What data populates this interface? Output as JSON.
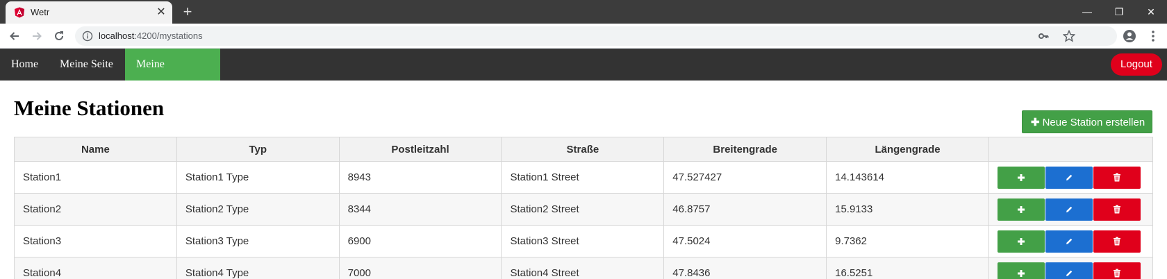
{
  "browser": {
    "tab_title": "Wetr",
    "url_host": "localhost",
    "url_path": ":4200/mystations"
  },
  "navbar": {
    "links": [
      {
        "label": "Home"
      },
      {
        "label": "Meine Seite"
      },
      {
        "label": "Meine Stationen",
        "active": true
      }
    ],
    "logout_label": "Logout"
  },
  "page": {
    "title": "Meine Stationen",
    "new_station_label": "Neue Station erstellen"
  },
  "table": {
    "columns": [
      "Name",
      "Typ",
      "Postleitzahl",
      "Straße",
      "Breitengrade",
      "Längengrade"
    ],
    "rows": [
      {
        "name": "Station1",
        "typ": "Station1 Type",
        "plz": "8943",
        "strasse": "Station1 Street",
        "breite": "47.527427",
        "laenge": "14.143614"
      },
      {
        "name": "Station2",
        "typ": "Station2 Type",
        "plz": "8344",
        "strasse": "Station2 Street",
        "breite": "46.8757",
        "laenge": "15.9133"
      },
      {
        "name": "Station3",
        "typ": "Station3 Type",
        "plz": "6900",
        "strasse": "Station3 Street",
        "breite": "47.5024",
        "laenge": "9.7362"
      },
      {
        "name": "Station4",
        "typ": "Station4 Type",
        "plz": "7000",
        "strasse": "Station4 Street",
        "breite": "47.8436",
        "laenge": "16.5251"
      }
    ]
  },
  "colors": {
    "navbar_bg": "#333333",
    "active_nav": "#4caf50",
    "add": "#43a047",
    "edit": "#1c6fd1",
    "delete": "#e0001b"
  }
}
